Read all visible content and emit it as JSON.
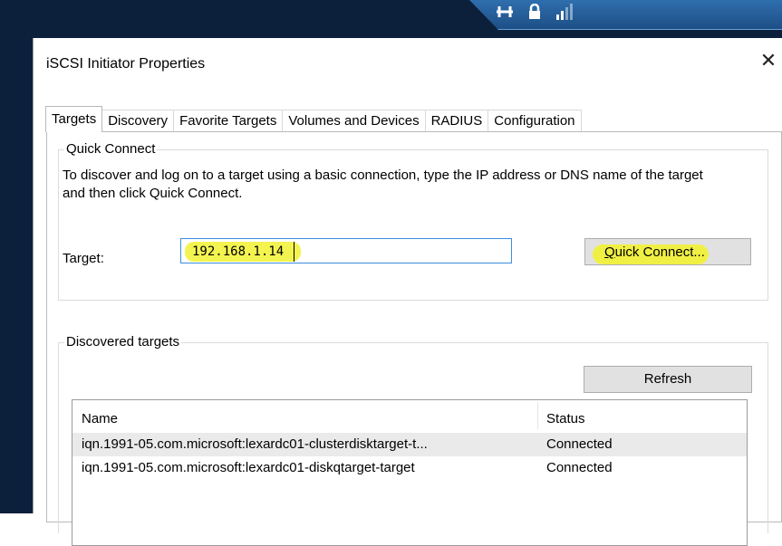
{
  "dialog": {
    "title": "iSCSI Initiator Properties",
    "close_glyph": "✕"
  },
  "tray": {
    "icons": [
      "network-icon",
      "lock-icon",
      "signal-icon"
    ],
    "glyphs": [
      "⊢⊣",
      "🔒"
    ]
  },
  "tabs": [
    {
      "label": "Targets",
      "active": true
    },
    {
      "label": "Discovery",
      "active": false
    },
    {
      "label": "Favorite Targets",
      "active": false
    },
    {
      "label": "Volumes and Devices",
      "active": false
    },
    {
      "label": "RADIUS",
      "active": false
    },
    {
      "label": "Configuration",
      "active": false
    }
  ],
  "quick_connect": {
    "group_label": "Quick Connect",
    "description": "To discover and log on to a target using a basic connection, type the IP address or DNS name of the target and then click Quick Connect.",
    "target_label": "Target:",
    "target_value": "192.168.1.14",
    "button_label_prefix": "Q",
    "button_label_rest": "uick Connect..."
  },
  "discovered": {
    "group_label": "Discovered targets",
    "refresh_label": "Refresh",
    "columns": [
      "Name",
      "Status"
    ],
    "rows": [
      {
        "name": "iqn.1991-05.com.microsoft:lexardc01-clusterdisktarget-t...",
        "status": "Connected"
      },
      {
        "name": "iqn.1991-05.com.microsoft:lexardc01-diskqtarget-target",
        "status": "Connected"
      }
    ]
  },
  "colors": {
    "highlight": "#f2f233",
    "input_border": "#3b8ee0",
    "desktop": "#0c1f3b"
  }
}
